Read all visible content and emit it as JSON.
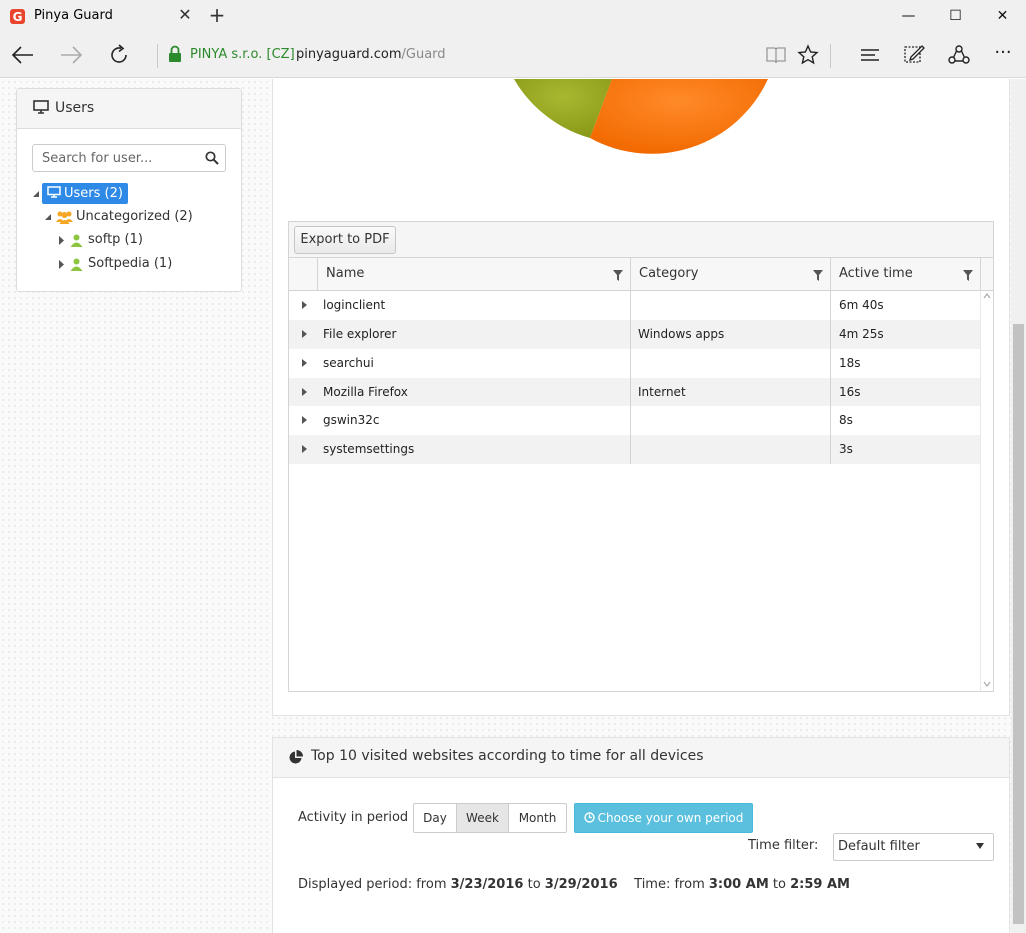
{
  "browser": {
    "tab_title": "Pinya Guard",
    "site_cert": "PINYA s.r.o. [CZ]",
    "url_host": "pinyaguard.com",
    "url_path": "/Guard"
  },
  "users_panel": {
    "title": "Users",
    "search_placeholder": "Search for user...",
    "tree": {
      "root": "Users (2)",
      "group": "Uncategorized (2)",
      "users": [
        "softp (1)",
        "Softpedia (1)"
      ]
    }
  },
  "pie": {
    "colors": [
      "#9aab22",
      "#ff7a14"
    ]
  },
  "grid": {
    "export_label": "Export to PDF",
    "columns": [
      "Name",
      "Category",
      "Active time"
    ],
    "rows": [
      {
        "name": "loginclient",
        "category": "",
        "time": "6m 40s"
      },
      {
        "name": "File explorer",
        "category": "Windows apps",
        "time": "4m 25s"
      },
      {
        "name": "searchui",
        "category": "",
        "time": "18s"
      },
      {
        "name": "Mozilla Firefox",
        "category": "Internet",
        "time": "16s"
      },
      {
        "name": "gswin32c",
        "category": "",
        "time": "8s"
      },
      {
        "name": "systemsettings",
        "category": "",
        "time": "3s"
      }
    ]
  },
  "websites": {
    "title": "Top 10 visited websites according to time for all devices",
    "activity_label": "Activity in period",
    "periods": [
      "Day",
      "Week",
      "Month"
    ],
    "selected_period": "Week",
    "choose_label": "Choose your own period",
    "time_filter_label": "Time filter:",
    "time_filter_value": "Default filter",
    "displayed_prefix": "Displayed period: from",
    "date_from": "3/23/2016",
    "to_word": "to",
    "date_to": "3/29/2016",
    "time_prefix": "Time: from",
    "time_from": "3:00 AM",
    "time_to": "2:59 AM"
  },
  "colors": {
    "accent": "#2e8ae6",
    "info_button": "#5bc0de",
    "cert_green": "#2b8a2b",
    "user_icon_green": "#8cc63f",
    "group_icon_orange": "#f5a623"
  }
}
